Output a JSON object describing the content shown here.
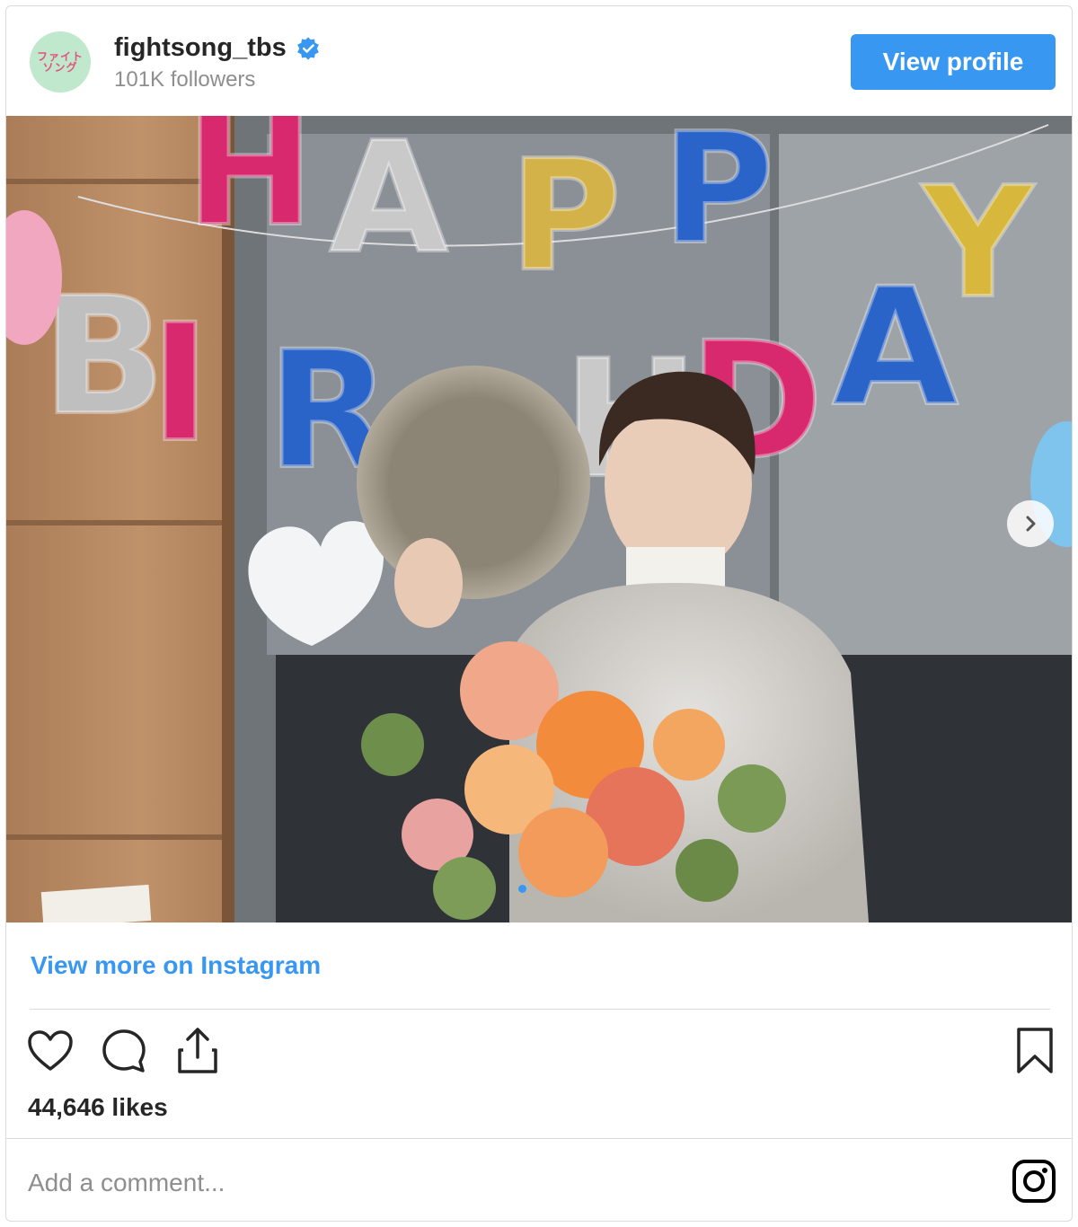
{
  "header": {
    "avatar_text_line1": "ファイト",
    "avatar_text_line2": "ソング",
    "username": "fightsong_tbs",
    "followers": "101K followers",
    "view_profile_label": "View profile"
  },
  "photo": {
    "balloon_text": "HAPPY BIRTHDAY",
    "carousel_current": 1
  },
  "footer": {
    "view_more_label": "View more on Instagram",
    "likes": "44,646 likes",
    "comment_placeholder": "Add a comment..."
  },
  "icons": {
    "verified": "verified-badge-icon",
    "like": "heart-icon",
    "comment": "comment-icon",
    "share": "share-icon",
    "save": "bookmark-icon",
    "instagram": "instagram-icon",
    "next": "chevron-right-icon"
  },
  "colors": {
    "accent": "#3897f0",
    "text": "#262626",
    "muted": "#8e8e8e",
    "avatar_bg": "#bfe8cc"
  }
}
